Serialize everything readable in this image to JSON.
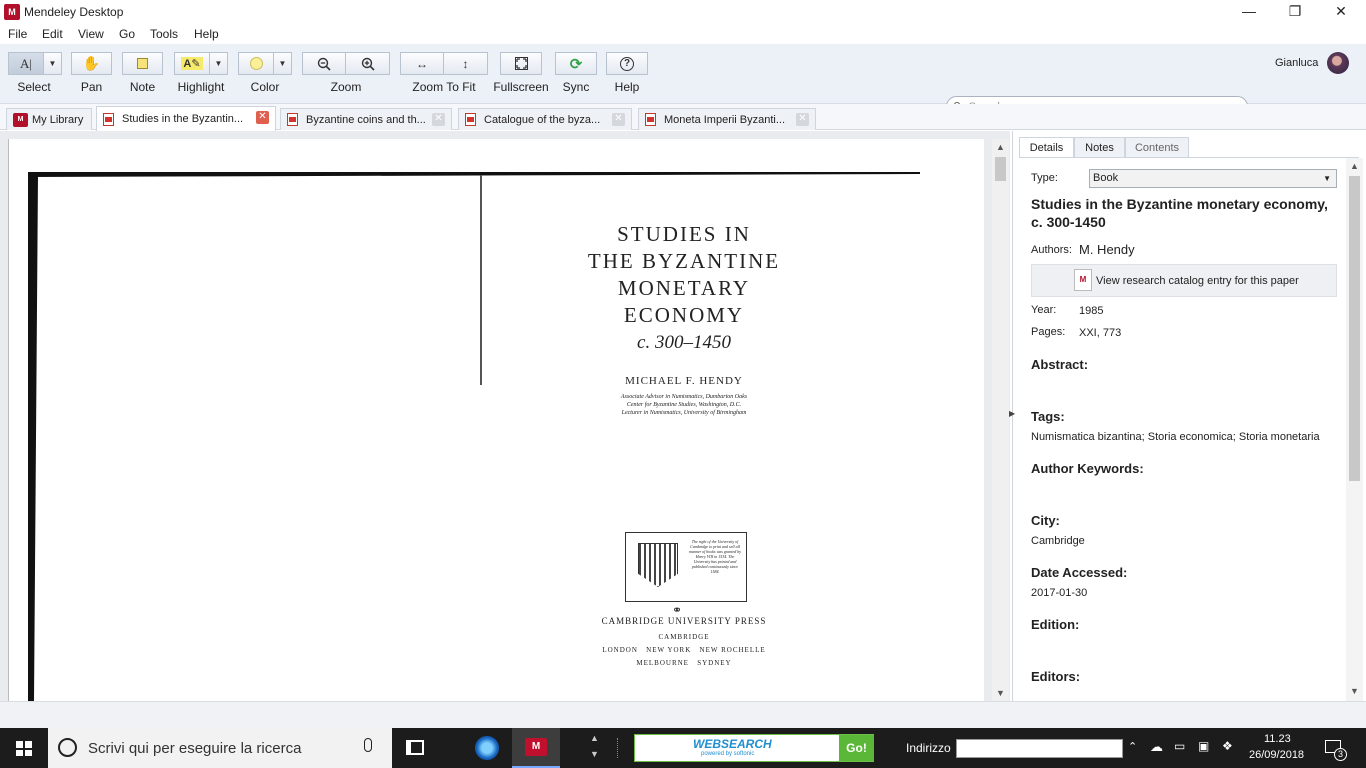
{
  "window": {
    "title": "Mendeley Desktop",
    "app_icon_text": "M",
    "controls": {
      "minimize": "—",
      "maximize": "❐",
      "close": "✕"
    }
  },
  "menu": [
    "File",
    "Edit",
    "View",
    "Go",
    "Tools",
    "Help"
  ],
  "toolbar": {
    "select": "Select",
    "pan": "Pan",
    "note": "Note",
    "highlight": "Highlight",
    "color": "Color",
    "zoom": "Zoom",
    "zoom_to_fit": "Zoom To Fit",
    "fullscreen": "Fullscreen",
    "sync": "Sync",
    "help": "Help",
    "search_placeholder": "Search...",
    "user_name": "Gianluca",
    "highlight_color": "#fbef9a"
  },
  "tabs": [
    {
      "label": "My Library"
    },
    {
      "label": "Studies in the Byzantin..."
    },
    {
      "label": "Byzantine coins and th..."
    },
    {
      "label": "Catalogue of the byza..."
    },
    {
      "label": "Moneta Imperii Byzanti..."
    }
  ],
  "book": {
    "title_lines": [
      "STUDIES IN",
      "THE BYZANTINE",
      "MONETARY",
      "ECONOMY"
    ],
    "date_range": "c. 300–1450",
    "author": "MICHAEL F. HENDY",
    "affiliation_lines": [
      "Associate Advisor in Numismatics, Dumbarton Oaks",
      "Center for Byzantine Studies, Washington, D.C.",
      "Lecturer in Numismatics, University of Birmingham"
    ],
    "emblem_text": "The right of the University of Cambridge to print and sell all manner of books was granted by Henry VIII in 1534. The University has printed and published continuously since 1584.",
    "publisher": "CAMBRIDGE UNIVERSITY PRESS",
    "publisher_city": "CAMBRIDGE",
    "cities_line1": "LONDON   NEW YORK   NEW ROCHELLE",
    "cities_line2": "MELBOURNE   SYDNEY"
  },
  "details": {
    "tabs": [
      "Details",
      "Notes",
      "Contents"
    ],
    "type_label": "Type:",
    "type_value": "Book",
    "title": "Studies in the Byzantine monetary economy, c. 300-1450",
    "authors_label": "Authors:",
    "authors_value": "M. Hendy",
    "catalog_button": "View research catalog entry for this paper",
    "year_label": "Year:",
    "year_value": "1985",
    "pages_label": "Pages:",
    "pages_value": "XXI, 773",
    "abstract_label": "Abstract:",
    "tags_label": "Tags:",
    "tags_value": "Numismatica bizantina; Storia economica; Storia monetaria",
    "author_keywords_label": "Author Keywords:",
    "city_label": "City:",
    "city_value": "Cambridge",
    "date_accessed_label": "Date Accessed:",
    "date_accessed_value": "2017-01-30",
    "edition_label": "Edition:",
    "editors_label": "Editors:"
  },
  "taskbar": {
    "search_placeholder": "Scrivi qui per eseguire la ricerca",
    "websearch_label": "WEBSEARCH",
    "websearch_sub": "powered by softonic",
    "go_button": "Go!",
    "address_label": "Indirizzo",
    "time": "11.23",
    "date": "26/09/2018",
    "notification_count": "3"
  }
}
